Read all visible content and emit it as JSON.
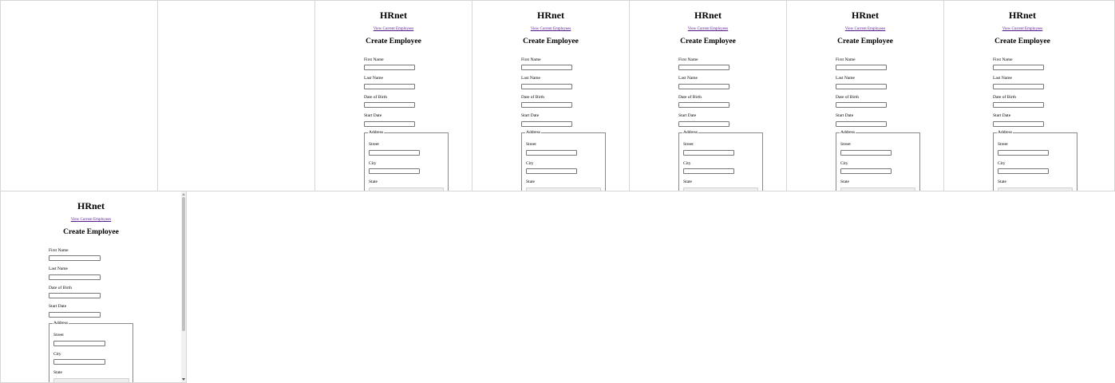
{
  "app": {
    "title": "HRnet",
    "nav_link": "View Current Employees",
    "form_title": "Create Employee"
  },
  "form": {
    "first_name_label": "First Name",
    "last_name_label": "Last Name",
    "dob_label": "Date of Birth",
    "start_date_label": "Start Date",
    "address_legend": "Address",
    "street_label": "Street",
    "city_label": "City",
    "state_label": "State",
    "first_name_value": "",
    "last_name_value": "",
    "dob_value": "",
    "start_date_value": "",
    "street_value": "",
    "city_value": "",
    "state_value": ""
  },
  "layout_note": ""
}
